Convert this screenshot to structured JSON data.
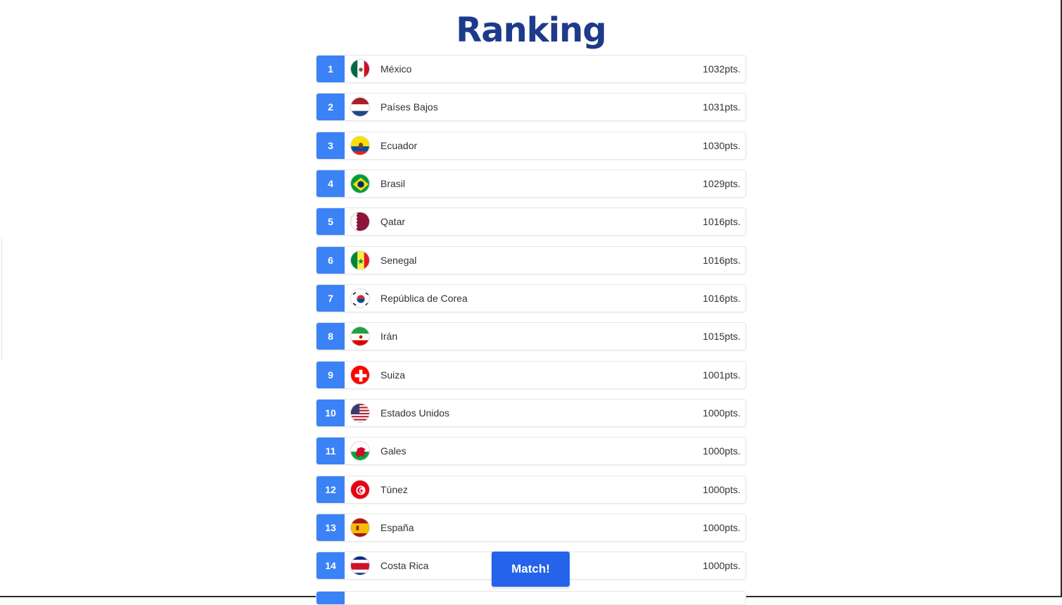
{
  "page": {
    "title": "Ranking"
  },
  "actions": {
    "match_label": "Match!"
  },
  "colors": {
    "title": "#1e3a8a",
    "rank_badge": "#3b82f6",
    "match_button": "#2563eb"
  },
  "ranking": [
    {
      "rank": "1",
      "country": "México",
      "points": "1032pts.",
      "flag": "mexico-flag-icon"
    },
    {
      "rank": "2",
      "country": "Países Bajos",
      "points": "1031pts.",
      "flag": "netherlands-flag-icon"
    },
    {
      "rank": "3",
      "country": "Ecuador",
      "points": "1030pts.",
      "flag": "ecuador-flag-icon"
    },
    {
      "rank": "4",
      "country": "Brasil",
      "points": "1029pts.",
      "flag": "brazil-flag-icon"
    },
    {
      "rank": "5",
      "country": "Qatar",
      "points": "1016pts.",
      "flag": "qatar-flag-icon"
    },
    {
      "rank": "6",
      "country": "Senegal",
      "points": "1016pts.",
      "flag": "senegal-flag-icon"
    },
    {
      "rank": "7",
      "country": "República de Corea",
      "points": "1016pts.",
      "flag": "south-korea-flag-icon"
    },
    {
      "rank": "8",
      "country": "Irán",
      "points": "1015pts.",
      "flag": "iran-flag-icon"
    },
    {
      "rank": "9",
      "country": "Suiza",
      "points": "1001pts.",
      "flag": "switzerland-flag-icon"
    },
    {
      "rank": "10",
      "country": "Estados Unidos",
      "points": "1000pts.",
      "flag": "usa-flag-icon"
    },
    {
      "rank": "11",
      "country": "Gales",
      "points": "1000pts.",
      "flag": "wales-flag-icon"
    },
    {
      "rank": "12",
      "country": "Túnez",
      "points": "1000pts.",
      "flag": "tunisia-flag-icon"
    },
    {
      "rank": "13",
      "country": "España",
      "points": "1000pts.",
      "flag": "spain-flag-icon"
    },
    {
      "rank": "14",
      "country": "Costa Rica",
      "points": "1000pts.",
      "flag": "costa-rica-flag-icon"
    }
  ]
}
